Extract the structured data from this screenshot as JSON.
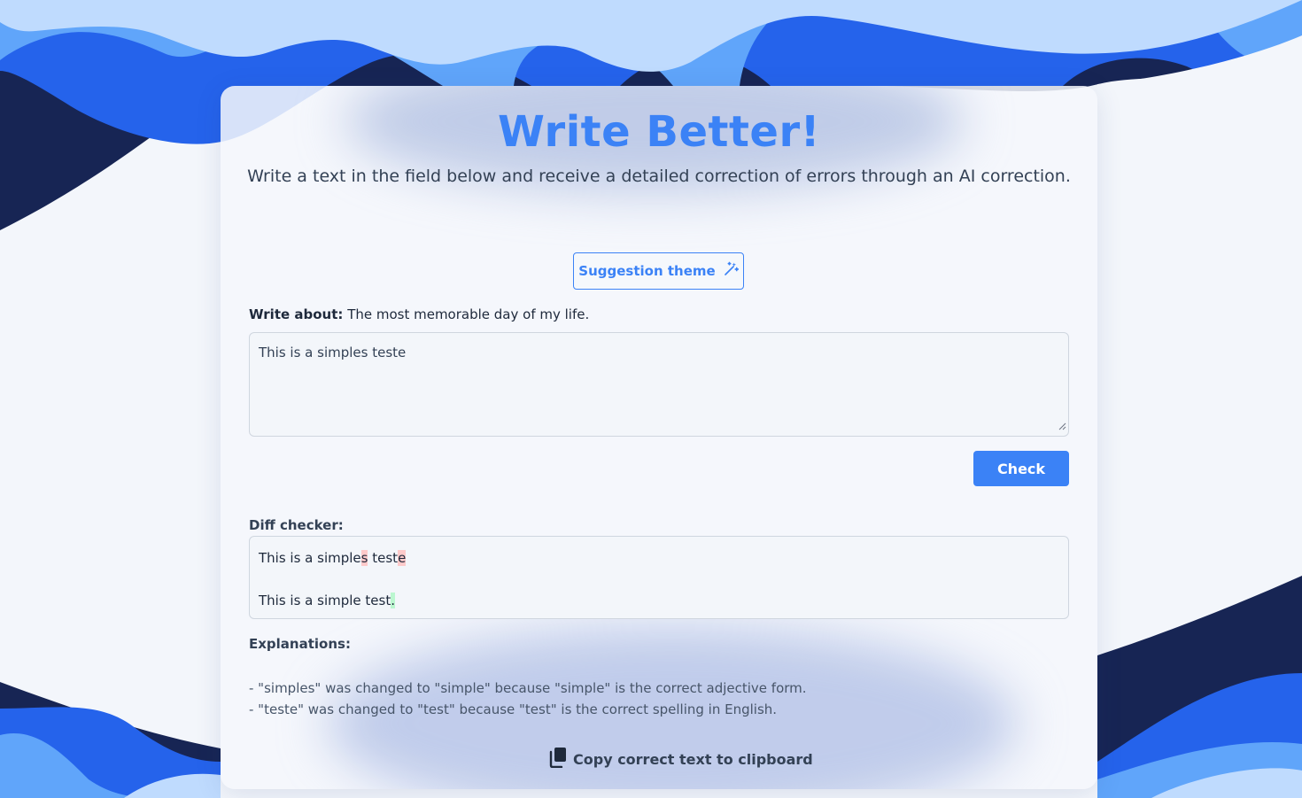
{
  "header": {
    "title": "Write Better!",
    "subtitle": "Write a text in the field below and receive a detailed correction of errors through an AI correction."
  },
  "suggestion": {
    "button_label": "Suggestion theme",
    "icon": "magic-wand-icon"
  },
  "prompt": {
    "label": "Write about:",
    "topic": "The most memorable day of my life."
  },
  "editor": {
    "value": "This is a simples teste"
  },
  "check": {
    "button_label": "Check"
  },
  "diff": {
    "label": "Diff checker:",
    "original": {
      "parts": [
        "This is a simple",
        "s",
        " test",
        "e"
      ],
      "kinds": [
        "same",
        "del",
        "same",
        "del"
      ]
    },
    "corrected": {
      "parts": [
        "This is a simple test",
        "."
      ],
      "kinds": [
        "same",
        "ins"
      ]
    },
    "colors": {
      "deleted": "#fecaca",
      "inserted": "#bbf7d0"
    }
  },
  "explanations": {
    "label": "Explanations:",
    "items": [
      "- \"simples\" was changed to \"simple\" because \"simple\" is the correct adjective form.",
      "- \"teste\" was changed to \"test\" because \"test\" is the correct spelling in English."
    ]
  },
  "copy": {
    "label": "Copy correct text to clipboard",
    "icon": "clipboard-copy-icon"
  },
  "colors": {
    "accent": "#3b82f6",
    "navy": "#172554",
    "wave_blue": "#2563eb",
    "wave_light": "#60a5fa",
    "wave_pale": "#bfdbfe"
  }
}
